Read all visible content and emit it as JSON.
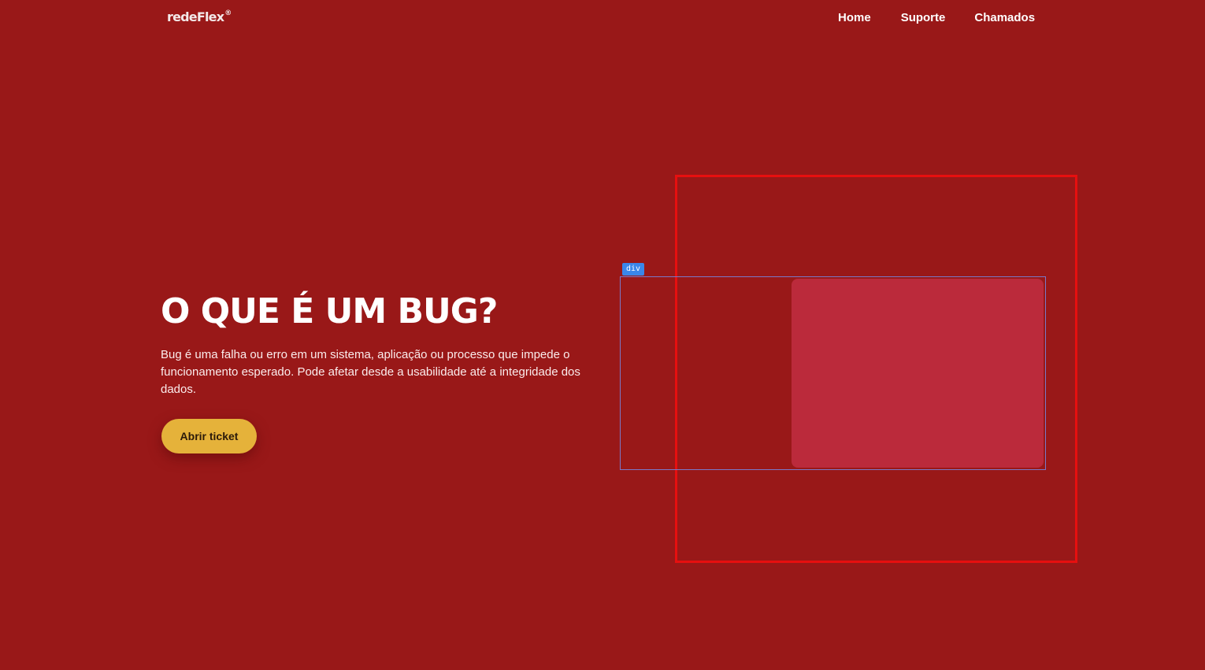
{
  "header": {
    "logo_text": "redeFlex",
    "logo_mark": "®",
    "nav": [
      {
        "label": "Home"
      },
      {
        "label": "Suporte"
      },
      {
        "label": "Chamados"
      }
    ]
  },
  "hero": {
    "title": "O QUE É UM BUG?",
    "description": "Bug é uma falha ou erro em um sistema, aplicação ou processo que impede o funcionamento esperado. Pode afetar desde a usabilidade até a integridade dos dados.",
    "cta_label": "Abrir ticket"
  },
  "inspector": {
    "tag_label": "div"
  },
  "colors": {
    "background": "#991818",
    "accent": "#e5b23a",
    "card": "#bb2a3b",
    "highlight_frame": "#e70f0f",
    "inspector_tag": "#3a86ea"
  }
}
